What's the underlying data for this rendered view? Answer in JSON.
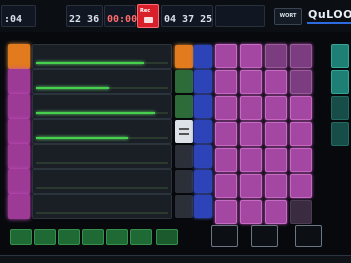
{
  "topbar": {
    "clock_caption": "",
    "clock_value": ":04",
    "elapsed_caption": "",
    "elapsed_value": "22 36",
    "remaining_value": "00:00",
    "rec_label": "Rec",
    "total_caption": "",
    "total_value": "04 37 25",
    "info_caption": "",
    "info_value": "",
    "mode_button": "WORT",
    "logo_text": "QuLOO"
  },
  "playlist": {
    "header": "",
    "rows": [
      {
        "title": "",
        "meta": "",
        "progress": 0.82
      },
      {
        "title": "",
        "meta": "",
        "progress": 0.55
      },
      {
        "title": "",
        "meta": "",
        "progress": 0.9
      },
      {
        "title": "",
        "meta": "",
        "progress": 0.7
      },
      {
        "title": "",
        "meta": "",
        "progress": 0.0
      },
      {
        "title": "",
        "meta": "",
        "progress": 0.0
      },
      {
        "title": "",
        "meta": "",
        "progress": 0.0
      }
    ]
  },
  "pads": {
    "header": "",
    "labels": [
      "",
      "",
      "",
      "",
      "",
      "",
      "",
      "",
      "",
      "",
      "",
      "",
      "",
      "",
      "",
      "",
      "",
      "",
      "",
      "",
      "",
      "",
      "",
      "",
      "",
      "",
      "",
      "",
      "",
      "",
      "",
      ""
    ],
    "side_labels": [
      "",
      "",
      "",
      ""
    ]
  },
  "bottom": {
    "buttons": [
      "",
      "",
      "",
      "",
      "",
      "",
      ""
    ],
    "wide_buttons": [
      "",
      "",
      "",
      ""
    ]
  },
  "footer": {
    "items": [
      "",
      "",
      "",
      "",
      ""
    ]
  },
  "colors": {
    "accent_magenta": "#a447a2",
    "accent_orange": "#e27a1e",
    "accent_blue": "#2c44b8",
    "accent_green": "#46d04e",
    "record_red": "#d8202a"
  }
}
